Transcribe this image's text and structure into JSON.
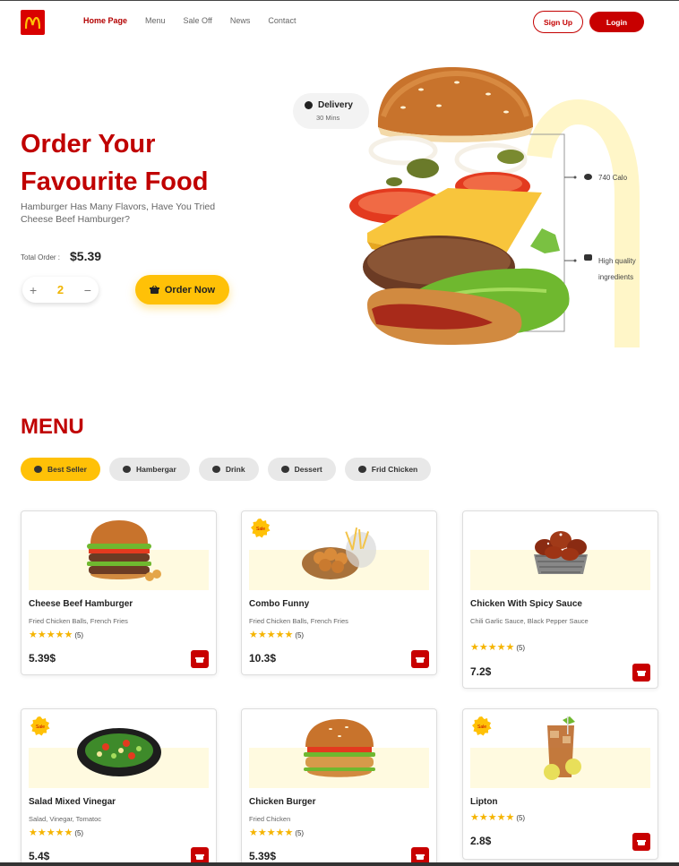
{
  "nav": {
    "items": [
      "Home Page",
      "Menu",
      "Sale Off",
      "News",
      "Contact"
    ],
    "signup": "Sign Up",
    "login": "Login"
  },
  "hero": {
    "title_line1": "Order Your",
    "title_line2": "Favourite Food",
    "subtitle": "Hamburger Has Many Flavors, Have You Tried Cheese Beef Hamburger?",
    "total_label": "Total Order :",
    "total_value": "$5.39",
    "quantity": "2",
    "order_button": "Order Now",
    "delivery_title": "Delivery",
    "delivery_time": "30 Mins",
    "callout_calories": "740 Calo",
    "callout_quality": "High quality ingredients"
  },
  "menu": {
    "title": "MENU",
    "categories": [
      "Best Seller",
      "Hambergar",
      "Drink",
      "Dessert",
      "Frid Chicken"
    ],
    "items": [
      {
        "name": "Cheese Beef Hamburger",
        "desc": "Fried Chicken Balls, French Fries",
        "stars": "★★★★★",
        "reviews": "(5)",
        "price": "5.39$",
        "sale": false,
        "sale_text": ""
      },
      {
        "name": "Combo Funny",
        "desc": "Fried Chicken Balls, French Fries",
        "stars": "★★★★★",
        "reviews": "(5)",
        "price": "10.3$",
        "sale": true,
        "sale_text": "Sale"
      },
      {
        "name": "Chicken With Spicy Sauce",
        "desc": "Chili Garlic Sauce, Black Pepper Sauce",
        "stars": "★★★★★",
        "reviews": "(5)",
        "price": "7.2$",
        "sale": false,
        "sale_text": ""
      },
      {
        "name": "Salad Mixed Vinegar",
        "desc": "Salad, Vinegar, Tomatoc",
        "stars": "★★★★★",
        "reviews": "(5)",
        "price": "5.4$",
        "sale": true,
        "sale_text": "Sale"
      },
      {
        "name": "Chicken Burger",
        "desc": "Fried Chicken",
        "stars": "★★★★★",
        "reviews": "(5)",
        "price": "5.39$",
        "sale": false,
        "sale_text": ""
      },
      {
        "name": "Lipton",
        "desc": "",
        "stars": "★★★★★",
        "reviews": "(5)",
        "price": "2.8$",
        "sale": true,
        "sale_text": "Sale"
      }
    ]
  },
  "colors": {
    "brand_red": "#c80000",
    "accent_yellow": "#ffc107"
  }
}
